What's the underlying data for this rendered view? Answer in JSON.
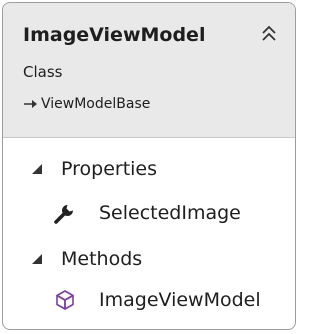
{
  "class_box": {
    "name": "ImageViewModel",
    "stereotype": "Class",
    "base_class": "ViewModelBase",
    "sections": [
      {
        "label": "Properties",
        "members": [
          {
            "label": "SelectedImage",
            "icon": "wrench-icon"
          }
        ]
      },
      {
        "label": "Methods",
        "members": [
          {
            "label": "ImageViewModel",
            "icon": "method-cube-icon",
            "color": "#7b3fa0"
          }
        ]
      }
    ]
  },
  "colors": {
    "header_bg": "#e9e9e9",
    "border": "#9d9d9d",
    "method_icon": "#7b3fa0"
  }
}
